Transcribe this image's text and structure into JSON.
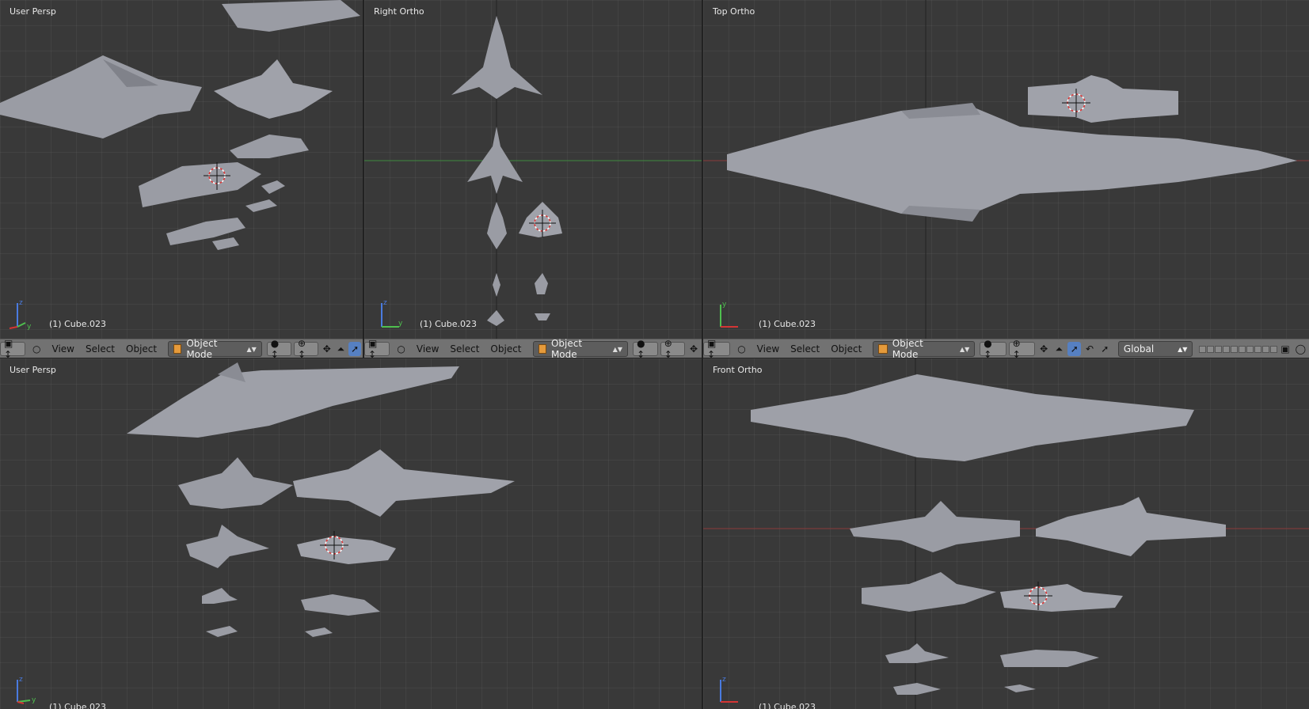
{
  "viewports": [
    {
      "label": "User Persp",
      "object": "(1) Cube.023"
    },
    {
      "label": "Right Ortho",
      "object": "(1) Cube.023"
    },
    {
      "label": "Top Ortho",
      "object": "(1) Cube.023"
    },
    {
      "label": "User Persp",
      "object": "(1) Cube.023"
    },
    {
      "label": "Front Ortho",
      "object": "(1) Cube.023"
    }
  ],
  "header": {
    "view_label": "View",
    "select_label": "Select",
    "object_label": "Object",
    "mode_label": "Object Mode",
    "orientation_label": "Global"
  },
  "axis_labels": {
    "x": "x",
    "y": "y",
    "z": "z"
  },
  "colors": {
    "background": "#393939",
    "header": "#727272",
    "active_icon": "#5680c2",
    "cube_icon": "#e59a3b"
  }
}
